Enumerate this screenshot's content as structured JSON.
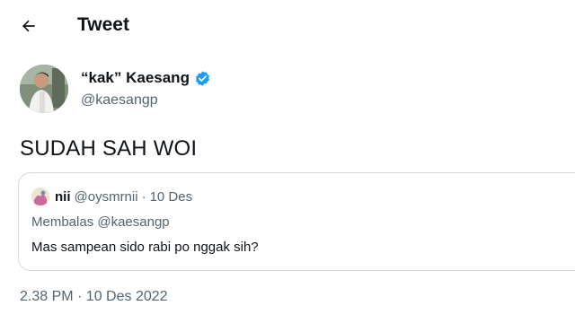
{
  "header": {
    "title": "Tweet"
  },
  "author": {
    "display_name": "“kak” Kaesang",
    "handle": "@kaesangp"
  },
  "tweet": {
    "text": "SUDAH SAH WOI",
    "timestamp": "2.38 PM · 10 Des 2022"
  },
  "quote": {
    "name": "nii",
    "handle": "@oysmrnii",
    "separator": "·",
    "date": "10 Des",
    "replying_to": "Membalas @kaesangp",
    "text": "Mas sampean sido rabi po nggak sih?"
  },
  "colors": {
    "text_primary": "#0f1419",
    "text_secondary": "#536471",
    "verified_blue": "#1d9bf0",
    "border": "#cfd9de"
  },
  "icons": {
    "back": "arrow-left-icon",
    "verified": "verified-badge-icon"
  }
}
